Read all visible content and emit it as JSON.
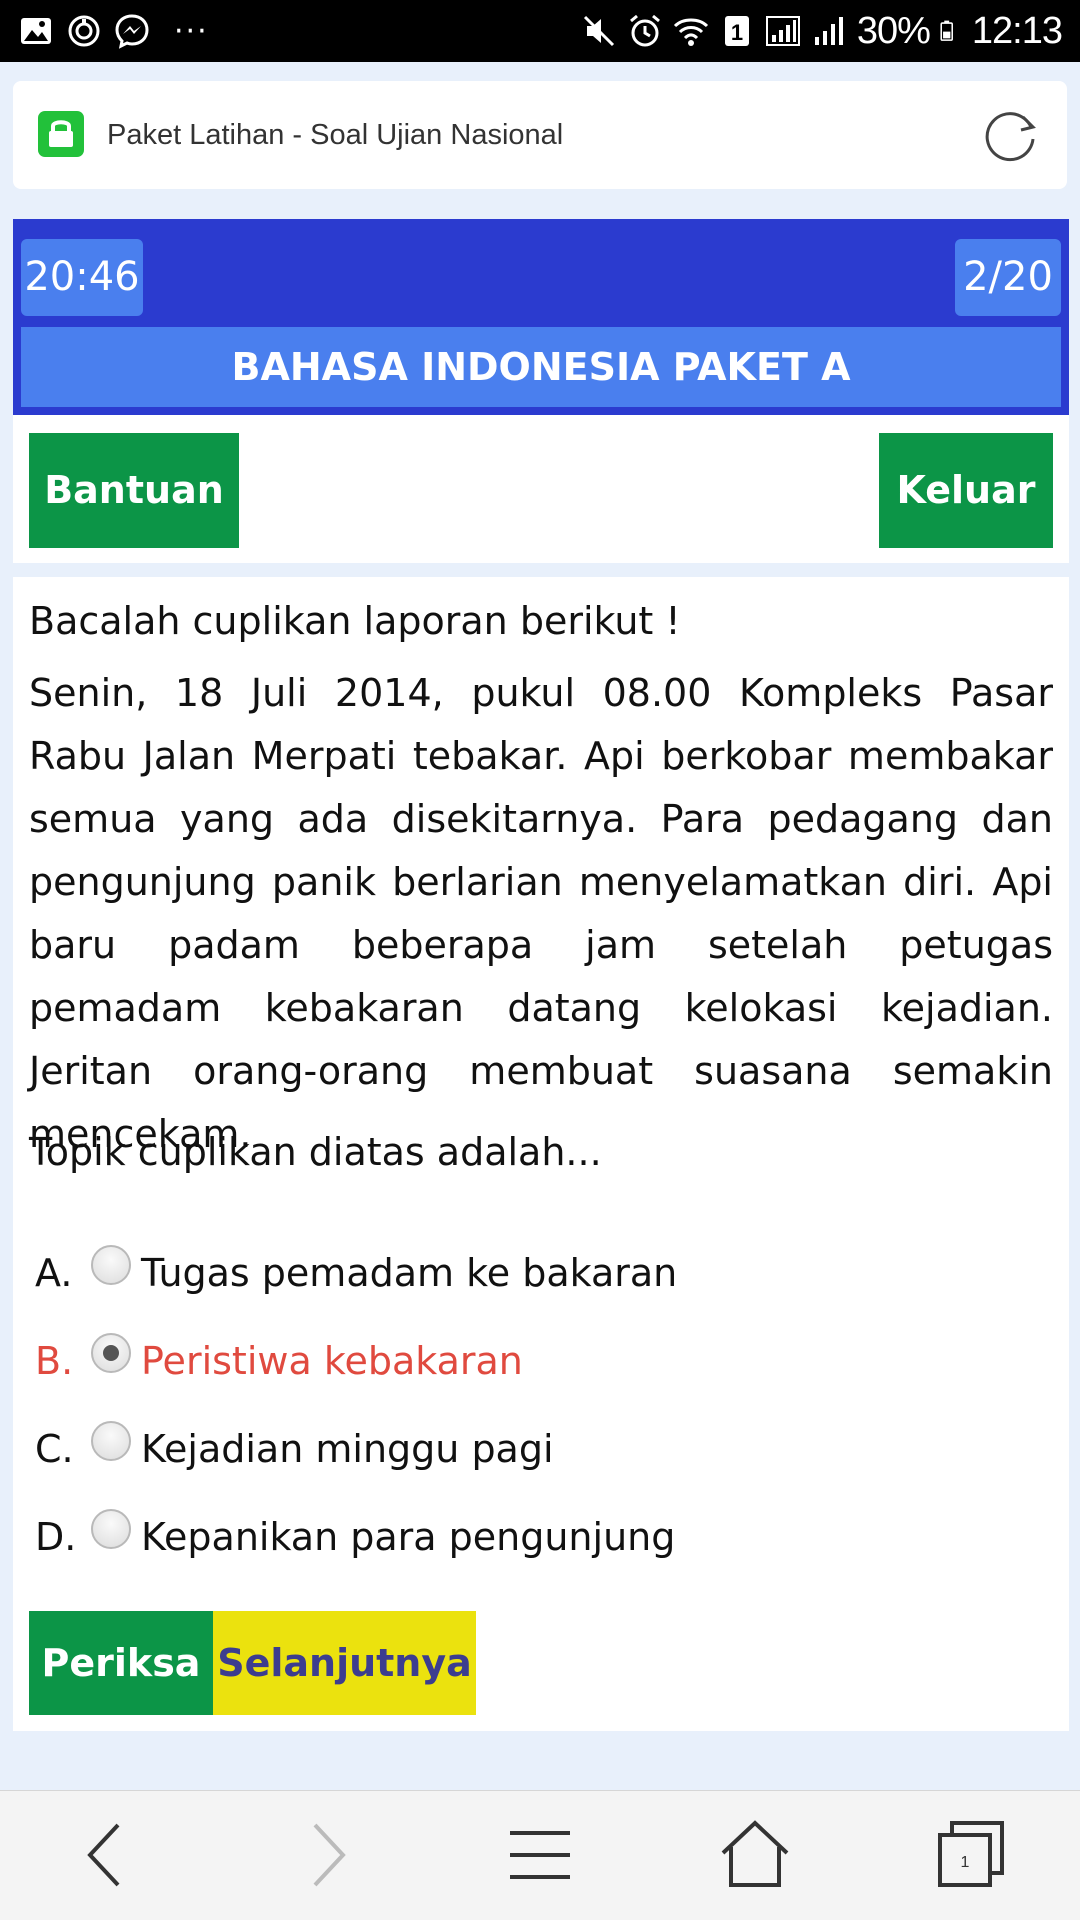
{
  "status_bar": {
    "battery_percent": "30%",
    "time": "12:13",
    "sim_slot": "1",
    "overflow": "···",
    "left_icons": [
      "gallery-icon",
      "sync-icon",
      "messenger-icon"
    ],
    "right_icons": [
      "mute-icon",
      "alarm-icon",
      "wifi-icon",
      "sim-icon",
      "signal-icon",
      "battery-icon"
    ]
  },
  "browser": {
    "page_title": "Paket Latihan - Soal Ujian Nasional",
    "lock_color": "#22c13a"
  },
  "quiz": {
    "timer": "20:46",
    "progress": "2/20",
    "subject": "BAHASA INDONESIA PAKET A",
    "help_label": "Bantuan",
    "exit_label": "Keluar",
    "intro": "Bacalah cuplikan laporan berikut !",
    "passage": "Senin, 18 Juli 2014, pukul 08.00 Kompleks Pasar Rabu Jalan Merpati tebakar. Api berkobar membakar semua yang ada disekitarnya. Para pedagang dan pengunjung panik berlarian menyelamatkan diri. Api baru padam beberapa jam setelah petugas pemadam kebakaran datang kelokasi kejadian. Jeritan orang-orang membuat suasana semakin mencekam.",
    "question": "Topik cuplikan diatas adalah...",
    "options": [
      {
        "letter": "A.",
        "text": "Tugas pemadam ke bakaran",
        "selected": false
      },
      {
        "letter": "B.",
        "text": "Peristiwa kebakaran",
        "selected": true
      },
      {
        "letter": "C.",
        "text": "Kejadian minggu pagi",
        "selected": false
      },
      {
        "letter": "D.",
        "text": "Kepanikan para pengunjung",
        "selected": false
      }
    ],
    "check_label": "Periksa",
    "next_label": "Selanjutnya",
    "colors": {
      "header_bg": "#2b3bcf",
      "header_chip": "#4a7fee",
      "green_button": "#0c9547",
      "yellow_button": "#ebe20e",
      "selected_option": "#e04a3f"
    }
  },
  "bottom_nav": {
    "tab_count": "1",
    "icons": [
      "back-icon",
      "forward-icon",
      "menu-icon",
      "home-icon",
      "tabs-icon"
    ]
  }
}
